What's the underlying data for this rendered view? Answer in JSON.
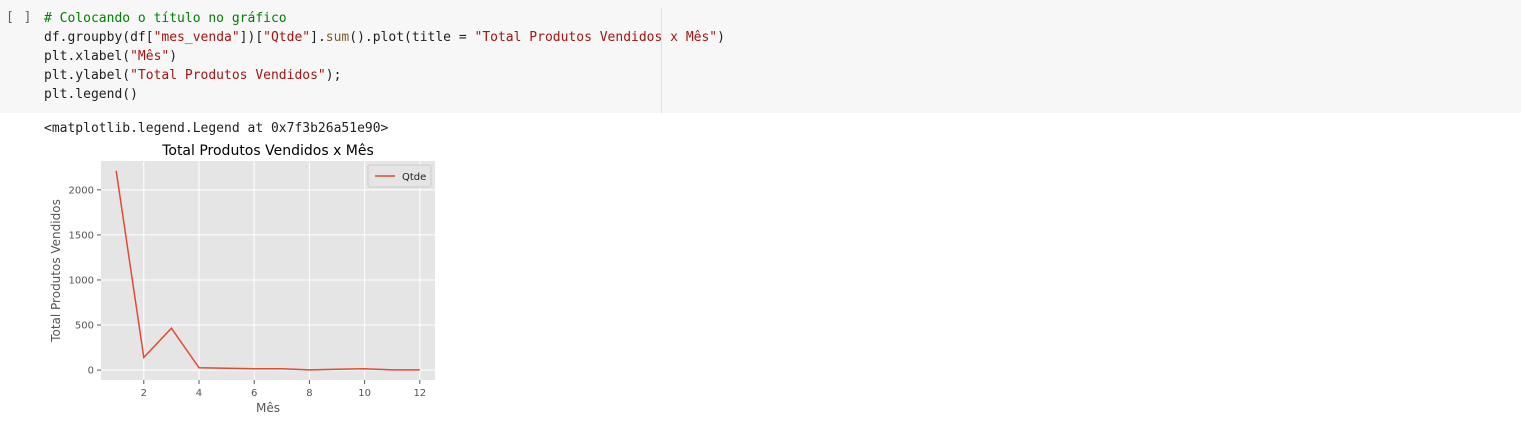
{
  "cell": {
    "run_label": "[ ]",
    "code_lines": [
      [
        {
          "t": "# Colocando o título no gráfico",
          "k": "comment"
        }
      ],
      [
        {
          "t": "df.groupby(df[",
          "k": "plain"
        },
        {
          "t": "\"mes_venda\"",
          "k": "string"
        },
        {
          "t": "])[",
          "k": "plain"
        },
        {
          "t": "\"Qtde\"",
          "k": "string"
        },
        {
          "t": "].",
          "k": "plain"
        },
        {
          "t": "sum",
          "k": "func"
        },
        {
          "t": "().plot(title = ",
          "k": "plain"
        },
        {
          "t": "\"Total Produtos Vendidos x Mês\"",
          "k": "string"
        },
        {
          "t": ")",
          "k": "plain"
        }
      ],
      [
        {
          "t": "plt.xlabel(",
          "k": "plain"
        },
        {
          "t": "\"Mês\"",
          "k": "string"
        },
        {
          "t": ")",
          "k": "plain"
        }
      ],
      [
        {
          "t": "plt.ylabel(",
          "k": "plain"
        },
        {
          "t": "\"Total Produtos Vendidos\"",
          "k": "string"
        },
        {
          "t": ");",
          "k": "plain"
        }
      ],
      [
        {
          "t": "plt.legend()",
          "k": "plain"
        }
      ]
    ]
  },
  "output": {
    "text": "<matplotlib.legend.Legend at 0x7f3b26a51e90>"
  },
  "chart_data": {
    "type": "line",
    "title": "Total Produtos Vendidos x Mês",
    "xlabel": "Mês",
    "ylabel": "Total Produtos Vendidos",
    "x": [
      1,
      2,
      3,
      4,
      5,
      6,
      7,
      8,
      9,
      10,
      11,
      12
    ],
    "series": [
      {
        "name": "Qtde",
        "values": [
          2210,
          140,
          465,
          25,
          20,
          15,
          15,
          2,
          10,
          15,
          2,
          2
        ],
        "color": "#e24a33"
      }
    ],
    "xlim": [
      0.45,
      12.55
    ],
    "ylim": [
      -110,
      2320
    ],
    "xticks": [
      2,
      4,
      6,
      8,
      10,
      12
    ],
    "yticks": [
      0,
      500,
      1000,
      1500,
      2000
    ],
    "grid": true,
    "legend": "top-right",
    "background": "#e5e5e5"
  }
}
